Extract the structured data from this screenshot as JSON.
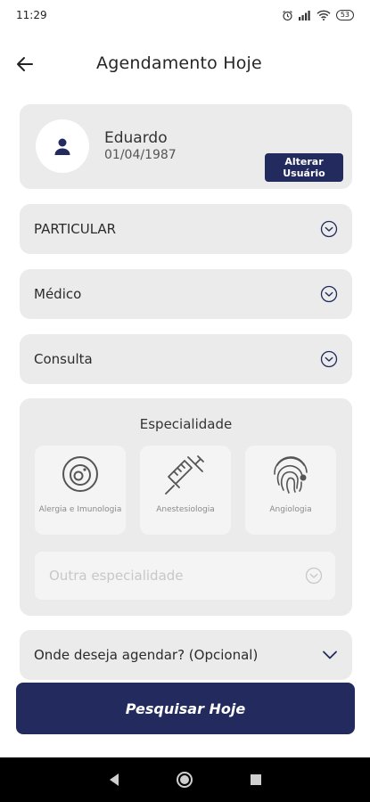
{
  "status_bar": {
    "time": "11:29",
    "battery": "53"
  },
  "header": {
    "title": "Agendamento Hoje"
  },
  "user": {
    "name": "Eduardo",
    "dob": "01/04/1987",
    "change_button": "Alterar Usuário"
  },
  "selects": {
    "plan": "PARTICULAR",
    "professional": "Médico",
    "type": "Consulta"
  },
  "specialty": {
    "title": "Especialidade",
    "tiles": [
      {
        "label": "Alergia e Imunologia",
        "icon": "allergy-icon"
      },
      {
        "label": "Anestesiologia",
        "icon": "syringe-icon"
      },
      {
        "label": "Angiologia",
        "icon": "fingerprint-icon"
      }
    ],
    "other_placeholder": "Outra especialidade"
  },
  "location": {
    "label": "Onde deseja agendar? (Opcional)"
  },
  "search_button": "Pesquisar Hoje",
  "colors": {
    "primary": "#222a5e",
    "card": "#ebebeb",
    "tile": "#f4f4f4"
  }
}
